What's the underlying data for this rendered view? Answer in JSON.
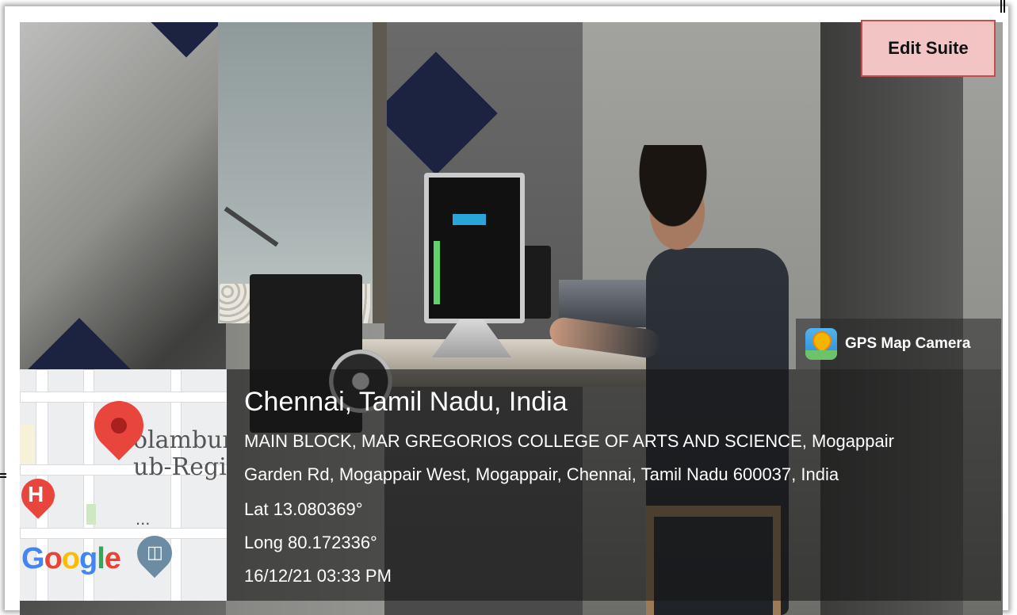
{
  "badge": {
    "label": "Edit Suite"
  },
  "gps_tag": {
    "icon": "gps-map-camera-icon",
    "label": "GPS Map Camera"
  },
  "location": {
    "city": "Chennai, Tamil Nadu, India",
    "address_line1": "MAIN BLOCK, MAR GREGORIOS COLLEGE OF ARTS AND SCIENCE, Mogappair",
    "address_line2": "Garden Rd, Mogappair West, Mogappair, Chennai, Tamil Nadu 600037, India",
    "lat": "Lat 13.080369°",
    "long": "Long 80.172336°",
    "datetime": "16/12/21 03:33 PM"
  },
  "map": {
    "label_line1": "olambur",
    "label_line2": "ub-Regis",
    "dots": "...",
    "hospital_letter": "H",
    "logo": "Google"
  }
}
